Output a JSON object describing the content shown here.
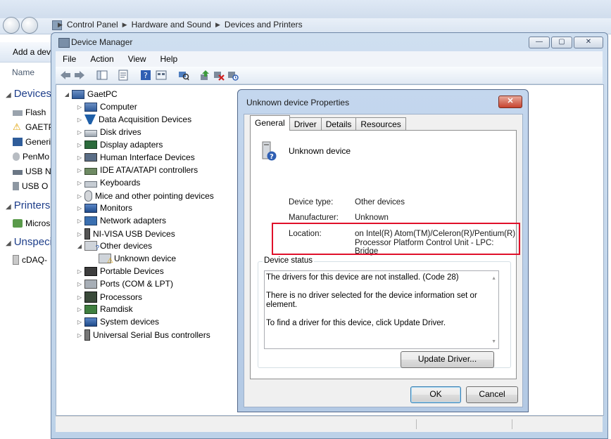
{
  "explorer": {
    "breadcrumbs": [
      "Control Panel",
      "Hardware and Sound",
      "Devices and Printers"
    ],
    "command": "Add a dev",
    "column_header": "Name",
    "groups": [
      {
        "label": "Devices",
        "items": [
          "Flash",
          "GAETP",
          "Generi",
          "PenMo",
          "USB N",
          "USB O"
        ]
      },
      {
        "label": "Printers",
        "items": [
          "Micros"
        ]
      },
      {
        "label": "Unspeci",
        "items": [
          "cDAQ-"
        ]
      }
    ]
  },
  "device_manager": {
    "title": "Device Manager",
    "window_buttons": {
      "minimize": "—",
      "maximize": "▢",
      "close": "✕"
    },
    "menu": [
      "File",
      "Action",
      "View",
      "Help"
    ],
    "tree": {
      "root": "GaetPC",
      "nodes": [
        {
          "label": "Computer",
          "icon": "computer-icon"
        },
        {
          "label": "Data Acquisition Devices",
          "icon": "daq-icon"
        },
        {
          "label": "Disk drives",
          "icon": "disk-icon"
        },
        {
          "label": "Display adapters",
          "icon": "display-icon"
        },
        {
          "label": "Human Interface Devices",
          "icon": "hid-icon"
        },
        {
          "label": "IDE ATA/ATAPI controllers",
          "icon": "ide-icon"
        },
        {
          "label": "Keyboards",
          "icon": "keyboard-icon"
        },
        {
          "label": "Mice and other pointing devices",
          "icon": "mouse-icon"
        },
        {
          "label": "Monitors",
          "icon": "monitor-icon"
        },
        {
          "label": "Network adapters",
          "icon": "network-icon"
        },
        {
          "label": "NI-VISA USB Devices",
          "icon": "usb-plug-icon"
        },
        {
          "label": "Other devices",
          "icon": "other-devices-icon",
          "expanded": true
        },
        {
          "label": "Unknown device",
          "icon": "warning-device-icon",
          "child": true
        },
        {
          "label": "Portable Devices",
          "icon": "portable-icon"
        },
        {
          "label": "Ports (COM & LPT)",
          "icon": "port-icon"
        },
        {
          "label": "Processors",
          "icon": "cpu-icon"
        },
        {
          "label": "Ramdisk",
          "icon": "ramdisk-icon"
        },
        {
          "label": "System devices",
          "icon": "system-icon"
        },
        {
          "label": "Universal Serial Bus controllers",
          "icon": "usb-icon"
        }
      ]
    }
  },
  "dialog": {
    "title": "Unknown device Properties",
    "close_label": "✕",
    "tabs": [
      "General",
      "Driver",
      "Details",
      "Resources"
    ],
    "device_name": "Unknown device",
    "properties": [
      {
        "label": "Device type:",
        "value": "Other devices"
      },
      {
        "label": "Manufacturer:",
        "value": "Unknown"
      },
      {
        "label": "Location:",
        "value": "on Intel(R) Atom(TM)/Celeron(R)/Pentium(R)",
        "value2": "Processor Platform Control Unit - LPC: Bridge"
      }
    ],
    "status_legend": "Device status",
    "status_lines": [
      "The drivers for this device are not installed. (Code 28)",
      "There is no driver selected for the device information set or element.",
      "To find a driver for this device, click Update Driver."
    ],
    "update_driver": "Update Driver...",
    "ok": "OK",
    "cancel": "Cancel"
  },
  "colors": {
    "highlight": "#e0102a",
    "group_header": "#1e3e8a"
  }
}
